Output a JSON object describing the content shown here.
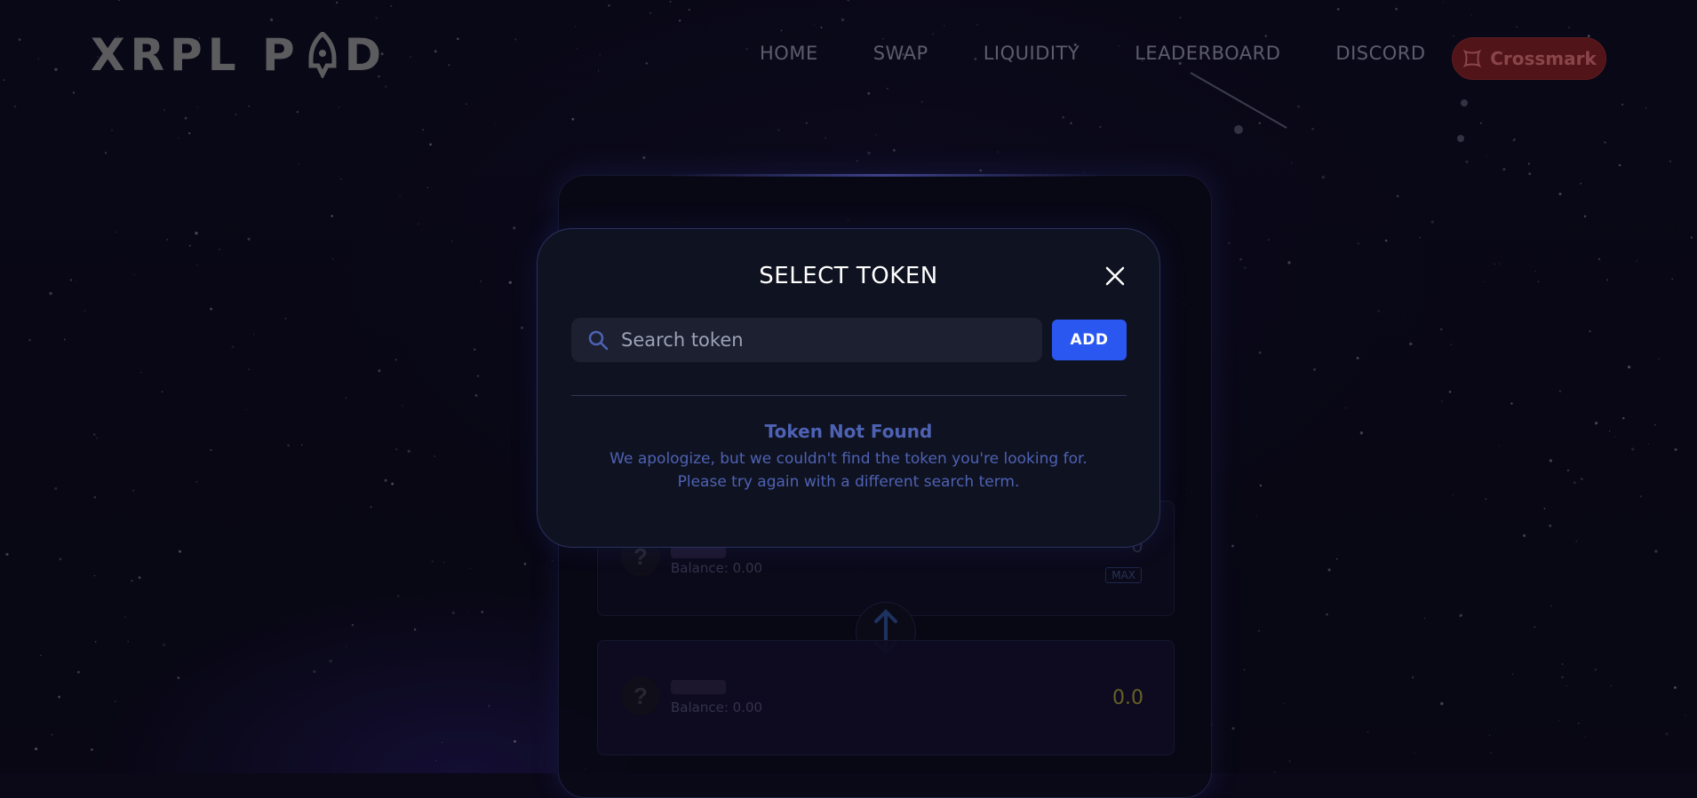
{
  "header": {
    "logo_text": "XRPL P  D",
    "nav": [
      {
        "label": "HOME"
      },
      {
        "label": "SWAP"
      },
      {
        "label": "LIQUIDITY"
      },
      {
        "label": "LEADERBOARD"
      },
      {
        "label": "DISCORD"
      }
    ],
    "wallet_button": {
      "label": "Crossmark",
      "icon": "crossmark-icon",
      "color": "#7a1c1e"
    }
  },
  "swap_card": {
    "from": {
      "balance": "Balance: 0.00",
      "amount": "0",
      "max_label": "MAX"
    },
    "to": {
      "balance": "Balance: 0.00",
      "amount": "0.0"
    },
    "unknown_token_symbol": "?"
  },
  "modal": {
    "title": "SELECT TOKEN",
    "search": {
      "placeholder": "Search token",
      "value": ""
    },
    "add_label": "ADD",
    "not_found_title": "Token Not Found",
    "not_found_line1": "We apologize, but we couldn't find the token you're looking for.",
    "not_found_line2": "Please try again with a different search term."
  },
  "colors": {
    "background": "#0b0818",
    "accent": "#2a57f0",
    "modal_bg": "#0f1220",
    "not_found_text": "#4e62b4"
  }
}
